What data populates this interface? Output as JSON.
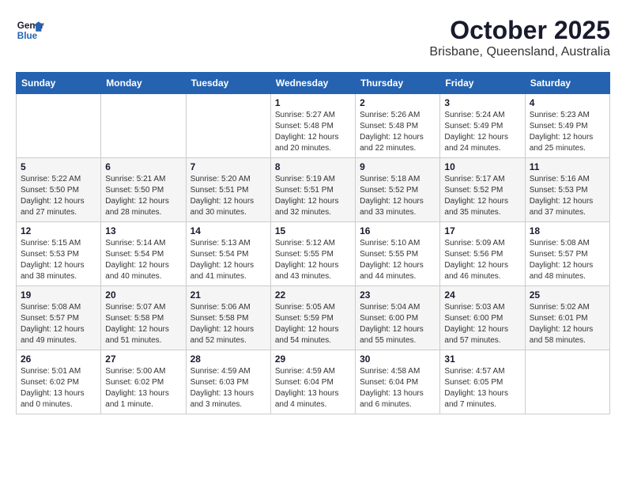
{
  "header": {
    "logo_line1": "General",
    "logo_line2": "Blue",
    "title": "October 2025",
    "subtitle": "Brisbane, Queensland, Australia"
  },
  "days_of_week": [
    "Sunday",
    "Monday",
    "Tuesday",
    "Wednesday",
    "Thursday",
    "Friday",
    "Saturday"
  ],
  "weeks": [
    [
      {
        "day": "",
        "info": ""
      },
      {
        "day": "",
        "info": ""
      },
      {
        "day": "",
        "info": ""
      },
      {
        "day": "1",
        "info": "Sunrise: 5:27 AM\nSunset: 5:48 PM\nDaylight: 12 hours\nand 20 minutes."
      },
      {
        "day": "2",
        "info": "Sunrise: 5:26 AM\nSunset: 5:48 PM\nDaylight: 12 hours\nand 22 minutes."
      },
      {
        "day": "3",
        "info": "Sunrise: 5:24 AM\nSunset: 5:49 PM\nDaylight: 12 hours\nand 24 minutes."
      },
      {
        "day": "4",
        "info": "Sunrise: 5:23 AM\nSunset: 5:49 PM\nDaylight: 12 hours\nand 25 minutes."
      }
    ],
    [
      {
        "day": "5",
        "info": "Sunrise: 5:22 AM\nSunset: 5:50 PM\nDaylight: 12 hours\nand 27 minutes."
      },
      {
        "day": "6",
        "info": "Sunrise: 5:21 AM\nSunset: 5:50 PM\nDaylight: 12 hours\nand 28 minutes."
      },
      {
        "day": "7",
        "info": "Sunrise: 5:20 AM\nSunset: 5:51 PM\nDaylight: 12 hours\nand 30 minutes."
      },
      {
        "day": "8",
        "info": "Sunrise: 5:19 AM\nSunset: 5:51 PM\nDaylight: 12 hours\nand 32 minutes."
      },
      {
        "day": "9",
        "info": "Sunrise: 5:18 AM\nSunset: 5:52 PM\nDaylight: 12 hours\nand 33 minutes."
      },
      {
        "day": "10",
        "info": "Sunrise: 5:17 AM\nSunset: 5:52 PM\nDaylight: 12 hours\nand 35 minutes."
      },
      {
        "day": "11",
        "info": "Sunrise: 5:16 AM\nSunset: 5:53 PM\nDaylight: 12 hours\nand 37 minutes."
      }
    ],
    [
      {
        "day": "12",
        "info": "Sunrise: 5:15 AM\nSunset: 5:53 PM\nDaylight: 12 hours\nand 38 minutes."
      },
      {
        "day": "13",
        "info": "Sunrise: 5:14 AM\nSunset: 5:54 PM\nDaylight: 12 hours\nand 40 minutes."
      },
      {
        "day": "14",
        "info": "Sunrise: 5:13 AM\nSunset: 5:54 PM\nDaylight: 12 hours\nand 41 minutes."
      },
      {
        "day": "15",
        "info": "Sunrise: 5:12 AM\nSunset: 5:55 PM\nDaylight: 12 hours\nand 43 minutes."
      },
      {
        "day": "16",
        "info": "Sunrise: 5:10 AM\nSunset: 5:55 PM\nDaylight: 12 hours\nand 44 minutes."
      },
      {
        "day": "17",
        "info": "Sunrise: 5:09 AM\nSunset: 5:56 PM\nDaylight: 12 hours\nand 46 minutes."
      },
      {
        "day": "18",
        "info": "Sunrise: 5:08 AM\nSunset: 5:57 PM\nDaylight: 12 hours\nand 48 minutes."
      }
    ],
    [
      {
        "day": "19",
        "info": "Sunrise: 5:08 AM\nSunset: 5:57 PM\nDaylight: 12 hours\nand 49 minutes."
      },
      {
        "day": "20",
        "info": "Sunrise: 5:07 AM\nSunset: 5:58 PM\nDaylight: 12 hours\nand 51 minutes."
      },
      {
        "day": "21",
        "info": "Sunrise: 5:06 AM\nSunset: 5:58 PM\nDaylight: 12 hours\nand 52 minutes."
      },
      {
        "day": "22",
        "info": "Sunrise: 5:05 AM\nSunset: 5:59 PM\nDaylight: 12 hours\nand 54 minutes."
      },
      {
        "day": "23",
        "info": "Sunrise: 5:04 AM\nSunset: 6:00 PM\nDaylight: 12 hours\nand 55 minutes."
      },
      {
        "day": "24",
        "info": "Sunrise: 5:03 AM\nSunset: 6:00 PM\nDaylight: 12 hours\nand 57 minutes."
      },
      {
        "day": "25",
        "info": "Sunrise: 5:02 AM\nSunset: 6:01 PM\nDaylight: 12 hours\nand 58 minutes."
      }
    ],
    [
      {
        "day": "26",
        "info": "Sunrise: 5:01 AM\nSunset: 6:02 PM\nDaylight: 13 hours\nand 0 minutes."
      },
      {
        "day": "27",
        "info": "Sunrise: 5:00 AM\nSunset: 6:02 PM\nDaylight: 13 hours\nand 1 minute."
      },
      {
        "day": "28",
        "info": "Sunrise: 4:59 AM\nSunset: 6:03 PM\nDaylight: 13 hours\nand 3 minutes."
      },
      {
        "day": "29",
        "info": "Sunrise: 4:59 AM\nSunset: 6:04 PM\nDaylight: 13 hours\nand 4 minutes."
      },
      {
        "day": "30",
        "info": "Sunrise: 4:58 AM\nSunset: 6:04 PM\nDaylight: 13 hours\nand 6 minutes."
      },
      {
        "day": "31",
        "info": "Sunrise: 4:57 AM\nSunset: 6:05 PM\nDaylight: 13 hours\nand 7 minutes."
      },
      {
        "day": "",
        "info": ""
      }
    ]
  ]
}
